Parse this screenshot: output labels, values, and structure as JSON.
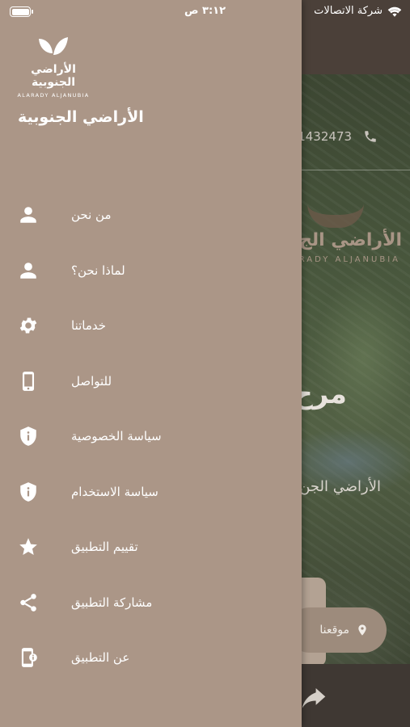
{
  "status_bar": {
    "carrier": "شركة الاتصالات",
    "time": "٣:١٢ ص",
    "battery_level": 1.0
  },
  "background": {
    "phone": "1432473",
    "logo_ar": "الأراضي الج",
    "logo_en": "RADY ALJANUBIA",
    "welcome": "مرح",
    "subtitle": "الأراضي الجن",
    "location_label": "موقعنا"
  },
  "drawer": {
    "brand": {
      "name_ar": "الأراضي الجنوبية",
      "name_en": "ALARADY ALJANUBIA"
    },
    "title": "الأراضي الجنوبية",
    "accent_color": "#ab9687",
    "menu": [
      {
        "label": "من نحن",
        "icon": "person-icon"
      },
      {
        "label": "لماذا نحن؟",
        "icon": "person-icon"
      },
      {
        "label": "خدماتنا",
        "icon": "gear-icon"
      },
      {
        "label": "للتواصل",
        "icon": "phone-icon"
      },
      {
        "label": "سياسة الخصوصية",
        "icon": "shield-info-icon"
      },
      {
        "label": "سياسة الاستخدام",
        "icon": "shield-info-icon"
      },
      {
        "label": "تقييم التطبيق",
        "icon": "star-icon"
      },
      {
        "label": "مشاركة التطبيق",
        "icon": "share-icon"
      },
      {
        "label": "عن التطبيق",
        "icon": "app-info-icon"
      }
    ]
  }
}
